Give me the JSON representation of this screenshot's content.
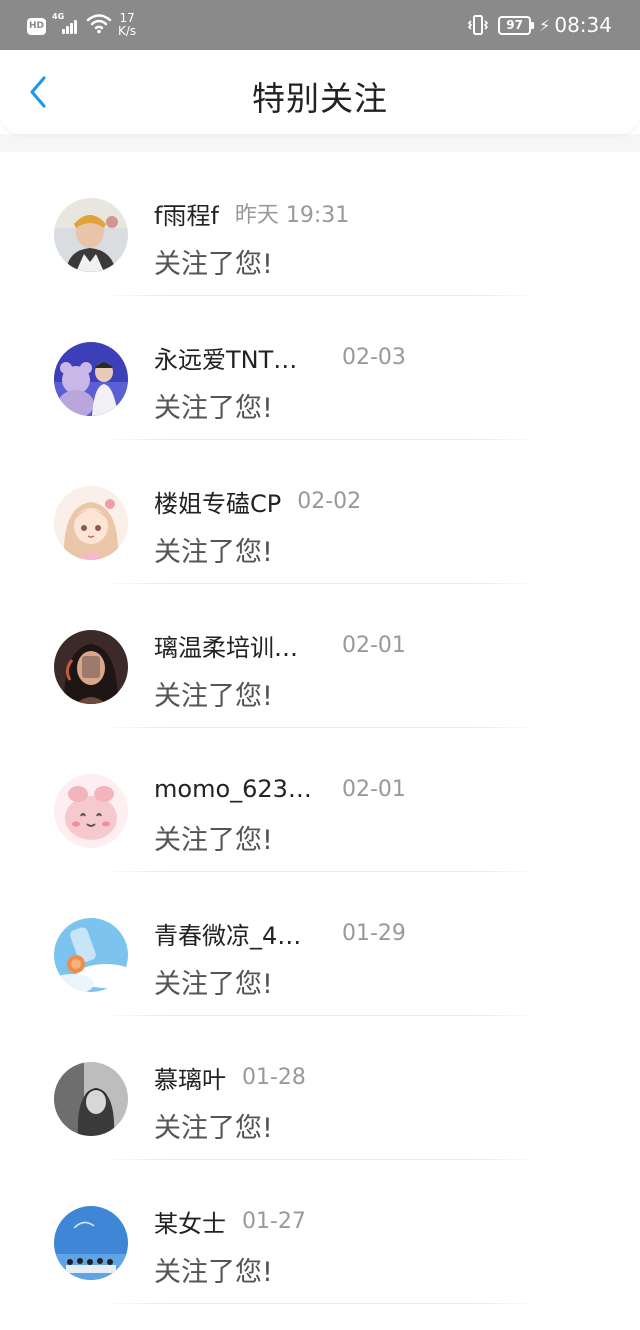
{
  "status_bar": {
    "hd": "HD",
    "network": "4G",
    "speed_value": "17",
    "speed_unit": "K/s",
    "battery": "97",
    "time": "08:34"
  },
  "header": {
    "back_icon": "chevron-left-icon",
    "title": "特别关注"
  },
  "colors": {
    "accent": "#1e9be8",
    "status_bar_bg": "#8a8a8a",
    "text_primary": "#222222",
    "text_secondary": "#555555",
    "text_time": "#999999"
  },
  "items": [
    {
      "name": "f雨程f",
      "time": "昨天 19:31",
      "message": "关注了您!",
      "avatar": "avatar-photo-young-man"
    },
    {
      "name": "永远爱TNT…",
      "time": "02-03",
      "message": "关注了您!",
      "avatar": "avatar-photo-with-teddy-bear"
    },
    {
      "name": "楼姐专磕CP",
      "time": "02-02",
      "message": "关注了您!",
      "avatar": "avatar-anime-girl"
    },
    {
      "name": "璃温柔培训…",
      "time": "02-01",
      "message": "关注了您!",
      "avatar": "avatar-photo-dark-portrait"
    },
    {
      "name": "momo_623…",
      "time": "02-01",
      "message": "关注了您!",
      "avatar": "avatar-cartoon-pink"
    },
    {
      "name": "青春微凉_4…",
      "time": "01-29",
      "message": "关注了您!",
      "avatar": "avatar-photo-drink-sky"
    },
    {
      "name": "慕璃叶",
      "time": "01-28",
      "message": "关注了您!",
      "avatar": "avatar-photo-grayscale"
    },
    {
      "name": "某女士",
      "time": "01-27",
      "message": "关注了您!",
      "avatar": "avatar-photo-blue-sky-group"
    }
  ]
}
